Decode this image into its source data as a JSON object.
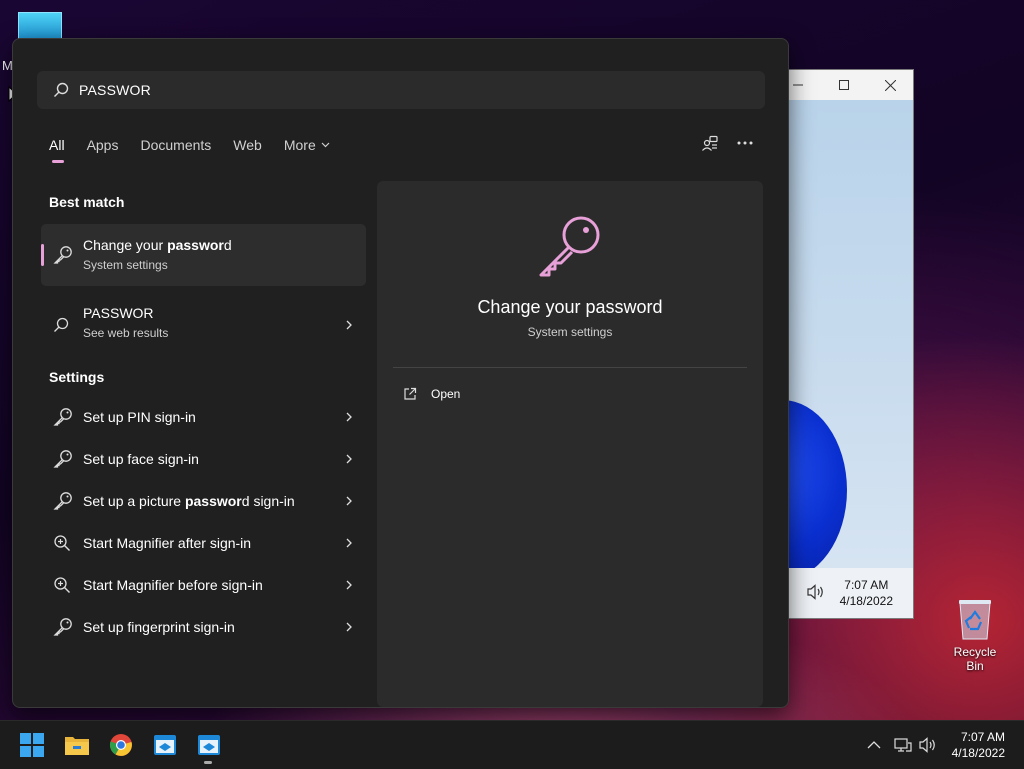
{
  "desktop": {
    "partial_label": "M",
    "recycle_bin_label": "Recycle Bin"
  },
  "background_window": {
    "time": "7:07 AM",
    "date": "4/18/2022"
  },
  "search": {
    "query": "PASSWOR"
  },
  "tabs": [
    {
      "label": "All",
      "active": true
    },
    {
      "label": "Apps"
    },
    {
      "label": "Documents"
    },
    {
      "label": "Web"
    },
    {
      "label": "More"
    }
  ],
  "sections": {
    "best_match": "Best match",
    "settings": "Settings"
  },
  "best_match": {
    "title_pre": "Change your ",
    "title_bold": "passwor",
    "title_post": "d",
    "subtitle": "System settings"
  },
  "web_result": {
    "title": "PASSWOR",
    "subtitle": "See web results"
  },
  "settings_items": [
    {
      "pre": "Set up PIN sign-in",
      "bold": "",
      "post": "",
      "icon": "key-icon"
    },
    {
      "pre": "Set up face sign-in",
      "bold": "",
      "post": "",
      "icon": "key-icon"
    },
    {
      "pre": "Set up a picture ",
      "bold": "passwor",
      "post": "d sign-in",
      "icon": "key-icon"
    },
    {
      "pre": "Start Magnifier after sign-in",
      "bold": "",
      "post": "",
      "icon": "magnifier-icon"
    },
    {
      "pre": "Start Magnifier before sign-in",
      "bold": "",
      "post": "",
      "icon": "magnifier-icon"
    },
    {
      "pre": "Set up fingerprint sign-in",
      "bold": "",
      "post": "",
      "icon": "key-icon"
    }
  ],
  "preview": {
    "title": "Change your password",
    "subtitle": "System settings",
    "open_label": "Open"
  },
  "taskbar": {
    "time": "7:07 AM",
    "date": "4/18/2022"
  },
  "colors": {
    "accent": "#e8a0d8",
    "panel_bg": "#202020"
  }
}
